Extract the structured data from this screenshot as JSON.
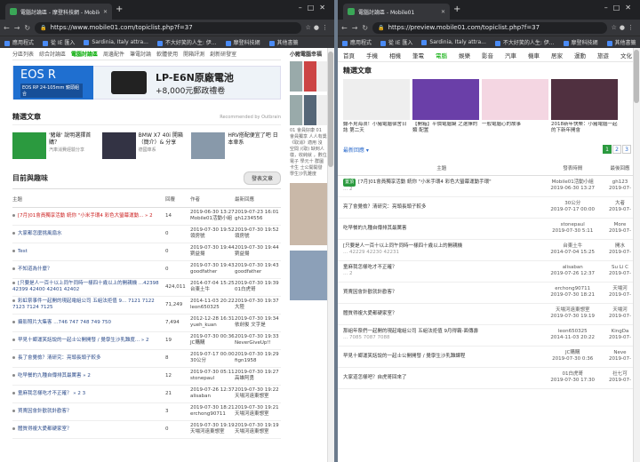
{
  "left_window": {
    "tab_title": "電腦討論區 - 摩登科技網 - Mobile01",
    "url": "https://www.mobile01.com/topiclist.php?f=37",
    "bookmarks": [
      "應用程式",
      "從 IE 匯入",
      "Sardinia, Italy attra...",
      "不大好笑的人生: 伊...",
      "摩登科技網",
      "其他書籤"
    ],
    "category_nav": [
      "分區列表",
      "綜合討論區",
      "電腦討論區",
      "周邊配件",
      "筆電討論",
      "軟體使用",
      "開箱評測",
      "創新研發室"
    ],
    "active_category": "電腦討論區",
    "banner": {
      "brand": "EOS R",
      "brand_sub": "EOS RP 24-105mm 鏡頭組合",
      "product": "LP-E6N原廠電池",
      "offer": "+8,000元郵政禮卷"
    },
    "featured_title": "精選文章",
    "recommended": "Recommended by Outbrain",
    "featured": [
      {
        "title": "'豬爺' 說明選擇首購？",
        "source": "汽車消費經驗分享"
      },
      {
        "title": "BMW X7 40i 開箱（簡介）& 分享",
        "source": "德國車系"
      },
      {
        "title": "HRV搭配便宜了吧 日本車系",
        "source": ""
      }
    ],
    "forum_title": "目前與趣味",
    "post_button": "發表文章",
    "columns": {
      "title": "主題",
      "replies": "回覆",
      "author": "作者",
      "last": "最新回應"
    },
    "rows": [
      {
        "title": "[7月]01會員獨享活動 統你 \"小米手環4 彩色大螢幕運動... » 2",
        "replies": "14",
        "a_date": "2019-06-30 13:27",
        "a_name": "Mobile01活動小組",
        "l_date": "2019-07-23 16:01",
        "l_name": "gh1234556",
        "red": true
      },
      {
        "title": "大家都怎麼挑風扇水",
        "replies": "0",
        "a_date": "2019-07-30 19:52",
        "a_name": "領房號",
        "l_date": "2019-07-30 19:52",
        "l_name": "領房號",
        "red": false
      },
      {
        "title": "Test",
        "replies": "0",
        "a_date": "2019-07-30 19:44",
        "a_name": "劉益揚",
        "l_date": "2019-07-30 19:44",
        "l_name": "劉益揚",
        "red": false
      },
      {
        "title": "不知道為什麼？",
        "replies": "0",
        "a_date": "2019-07-30 19:43",
        "a_name": "goodfather",
        "l_date": "2019-07-30 19:43",
        "l_name": "goodfather",
        "red": false
      },
      {
        "title": "[只要是人一百十以上同午同時一樣四十歲以上的開親機 ...42398 42399 42400 42401 42402",
        "replies": "424,011",
        "a_date": "2014-07-04 15:25",
        "a_name": "台東土牛",
        "l_date": "2019-07-30 19:39",
        "l_name": "01白虎哥",
        "red": false
      },
      {
        "title": "彩虹祭事件一起開的現起電組公司 五組法拒值 9... 7121 7122 7123 7124 7125",
        "replies": "71,249",
        "a_date": "2014-11-03 20:22",
        "a_name": "leon650325",
        "l_date": "2019-07-30 19:37",
        "l_name": "大陸",
        "red": false
      },
      {
        "title": "攝影照片大集客 ...746 747 748 749 750",
        "replies": "7,494",
        "a_date": "2012-12-28 16:31",
        "a_name": "yueh_kuan",
        "l_date": "2019-07-30 19:34",
        "l_name": "依劍俊 文字是",
        "red": false
      },
      {
        "title": "早見十鄉運笑話說的一起士公開開發 / 覺學生沙乳難度... » 2",
        "replies": "19",
        "a_date": "2019-07-30 00:36",
        "a_name": "JC購購",
        "l_date": "2019-07-30 19:33",
        "l_name": "NeverGiveUp!!",
        "red": false
      },
      {
        "title": "長了會覺檢？清研究：亮頭長頭子較多",
        "replies": "8",
        "a_date": "2019-07-17 00:00",
        "a_name": "30公分",
        "l_date": "2019-07-30 19:29",
        "l_name": "fign1958",
        "red": false
      },
      {
        "title": "吃早餐的九種自傳排其最厲害 » 2",
        "replies": "12",
        "a_date": "2019-07-30 05:11",
        "a_name": "stonepaul",
        "l_date": "2019-07-30 19:27",
        "l_name": "高雄阿勇",
        "red": false
      },
      {
        "title": "童麻我怎樣吃才不正確？ » 2 3",
        "replies": "21",
        "a_date": "2019-07-26 12:37",
        "a_name": "alisaban",
        "l_date": "2019-07-30 19:22",
        "l_name": "天場河遠東想室",
        "red": false
      },
      {
        "title": "買賣因會針歡就針歡客？",
        "replies": "3",
        "a_date": "2019-07-30 18:21",
        "a_name": "erchong90711",
        "l_date": "2019-07-30 19:21",
        "l_name": "天場河遠東想室",
        "red": false
      },
      {
        "title": "體質得複大愛都硬家室？",
        "replies": "0",
        "a_date": "2019-07-30 19:19",
        "a_name": "天場河遠東想室",
        "l_date": "2019-07-30 19:19",
        "l_name": "天場河遠東想室",
        "red": false
      }
    ],
    "side_title": "小豬電腦幸福",
    "side_text": "01 會員好康 01 會員獨享 人人有獎《取消》適用 沒 空間 /(取) 缺到人樣，收純就 ，數位電子 學元十 群圖 卡生 士公開開發 學生沙乳難度"
  },
  "right_window": {
    "tab_title": "電腦討論區 - Mobile01",
    "url": "https://preview.mobile01.com/topiclist.php?f=37",
    "bookmarks": [
      "應用程式",
      "從 IE 匯入",
      "Sardinia, Italy attra...",
      "不大好笑的人生: 伊...",
      "摩登科技網",
      "其他書籤"
    ],
    "tabs": [
      "首頁",
      "手機",
      "相機",
      "筆電",
      "電腦",
      "娛樂",
      "影音",
      "汽車",
      "機車",
      "居家",
      "運動",
      "旅遊",
      "文化"
    ],
    "active_tab": "電腦",
    "section_title": "精選文章",
    "cards": [
      {
        "title": "聽不見海浪！小豬電腦宿舍日誌 第二天"
      },
      {
        "title": "【開箱】平價電腦鍵 之選擇的類 配置"
      },
      {
        "title": "一般電腦心的故事"
      },
      {
        "title": "2018新年快樂：小豬電腦一起的下新年開會"
      }
    ],
    "latest": "最新回應 ▾",
    "pages": [
      "1",
      "2",
      "3"
    ],
    "columns": {
      "title": "主題",
      "author": "發表時間",
      "last": "最後回應"
    },
    "rows": [
      {
        "badge": "置頂",
        "title": "[7月]01會員獨享活動 統你 \"小米手環4 彩色大螢幕運動手環\"",
        "sub": "... 2",
        "a_name": "Mobile01活動小組",
        "a_date": "2019-06-30 13:27",
        "l_name": "gh123",
        "l_date": "2019-07-"
      },
      {
        "badge": "",
        "title": "亮了會覺檢？清研究：亮頭長頭子較多",
        "sub": "",
        "a_name": "30公分",
        "a_date": "2019-07-17 00:00",
        "l_name": "大者",
        "l_date": "2019-07-"
      },
      {
        "badge": "",
        "title": "吃早餐的九種自傳排其最厲害",
        "sub": "",
        "a_name": "stonepaul",
        "a_date": "2019-07-30 5:11",
        "l_name": "More",
        "l_date": "2019-07-"
      },
      {
        "badge": "",
        "title": "[只要是人一百十以上同午同時一樣四十歲以上的開親機",
        "sub": "... 42229 42230 42231",
        "a_name": "台東土牛",
        "a_date": "2014-07-04 15:25",
        "l_name": "開水",
        "l_date": "2019-07-"
      },
      {
        "badge": "",
        "title": "童麻我怎樣吃才不正確？",
        "sub": "... 2",
        "a_name": "alisaban",
        "a_date": "2019-07-26 12:37",
        "l_name": "Su Li C",
        "l_date": "2019-07-"
      },
      {
        "badge": "",
        "title": "買賣因會針歡就針歡客？",
        "sub": "",
        "a_name": "erchong90711",
        "a_date": "2019-07-30 18:21",
        "l_name": "天場河",
        "l_date": "2019-07-"
      },
      {
        "badge": "",
        "title": "體質得複大愛都硬家室？",
        "sub": "",
        "a_name": "天場河遠東想室",
        "a_date": "2019-07-30 19:19",
        "l_name": "天場河",
        "l_date": "2019-07-"
      },
      {
        "badge": "",
        "title": "那組年祭們一起開的現起電組公司 五組法拒值 9月得霸-面傳壽",
        "sub": "... 7085 7087 7088",
        "a_name": "leon650325",
        "a_date": "2014-11-03 20:22",
        "l_name": "KingDa",
        "l_date": "2019-07-"
      },
      {
        "badge": "",
        "title": "早見十鄉運笑話說的一起士公開開發 / 覺學生沙乳難課程",
        "sub": "",
        "a_name": "JC購購",
        "a_date": "2019-07-30 0:36",
        "l_name": "Neve",
        "l_date": "2019-07-"
      },
      {
        "badge": "",
        "title": "大家道怎樣吧？自虎哥回來了",
        "sub": "",
        "a_name": "01白虎哥",
        "a_date": "2019-07-30 17:30",
        "l_name": "社七可",
        "l_date": "2019-07-"
      }
    ]
  },
  "colors": {
    "green": "#2b9a3f",
    "link": "#2b4b8a",
    "chrome_dark": "#202124",
    "chrome_tab": "#35363a"
  }
}
